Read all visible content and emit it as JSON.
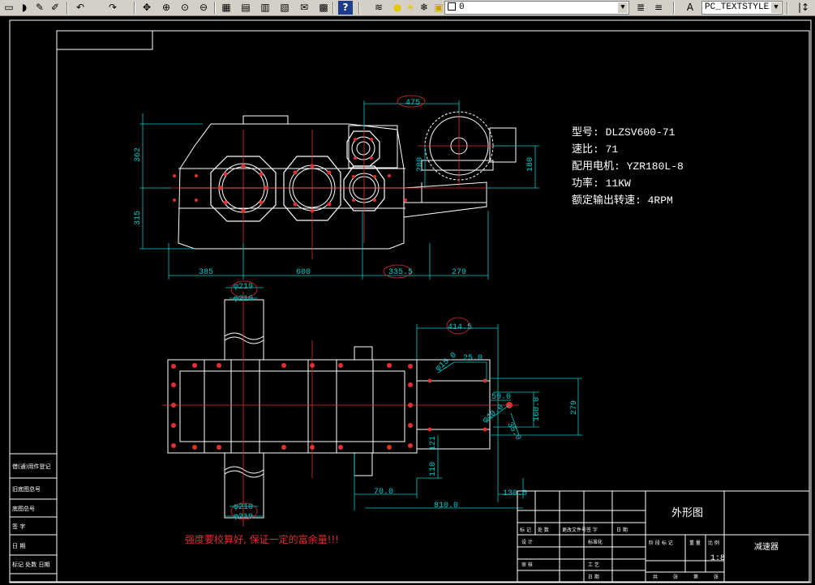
{
  "toolbar": {
    "layer_value": "0",
    "textstyle_value": "PC_TEXTSTYLE",
    "icons": [
      "new-icon",
      "open-icon",
      "save-icon",
      "plot-icon",
      "undo-icon",
      "redo-icon",
      "pan-icon",
      "zoom-realtime-icon",
      "zoom-window-icon",
      "zoom-previous-icon",
      "properties-icon",
      "design-center-icon",
      "tool-palettes-icon",
      "sheet-set-icon",
      "markup-icon",
      "calculator-icon",
      "help-icon",
      "layers-icon",
      "lightbulb-icon",
      "sun-icon",
      "freeze-icon",
      "lock-icon",
      "text-style-icon"
    ]
  },
  "specs": {
    "model": "型号: DLZSV600-71",
    "ratio": "速比: 71",
    "motor": "配用电机: YZR180L-8",
    "power": "功率: 11KW",
    "speed": "额定输出转速: 4RPM"
  },
  "dims_top": {
    "d475": "475",
    "d362": "362",
    "d315": "315",
    "d385": "385",
    "d600": "600",
    "d3355": "335.5",
    "d279": "279",
    "d180": "180",
    "d200": "200"
  },
  "dims_bottom": {
    "phi219_top": "φ219",
    "phi210_top": "φ210",
    "d4145": "414.5",
    "phi150": "φ15.0",
    "d250": "25.0",
    "d590": "59.0",
    "phi400": "φ40.0",
    "d1600": "160.0",
    "d279": "279",
    "d350": "35.0",
    "d121": "121",
    "d110": "110",
    "d700": "70.0",
    "d1300": "130.0",
    "d8100": "810.0",
    "phi210_bot": "φ210",
    "phi219_bot": "φ219"
  },
  "note": "强度要校算好, 保证一定的富余量!!!",
  "title_block": {
    "drawing_name": "外形图",
    "part_name": "减速器",
    "scale": "1:8",
    "headers": [
      "标 记",
      "处 数",
      "更改文件号",
      "签 字",
      "日 期"
    ],
    "rows": [
      "设 计",
      "标准化",
      "审 核",
      "工 艺",
      "日 期"
    ],
    "stage": [
      "阶 段 标 记",
      "重 量",
      "比 例"
    ],
    "bottom": [
      "共",
      "张",
      "第",
      "张"
    ]
  },
  "left_block": [
    "借(通)用件登记",
    "旧底图总号",
    "底图总号",
    "签 字",
    "日 期",
    "标记 处数 日期"
  ]
}
